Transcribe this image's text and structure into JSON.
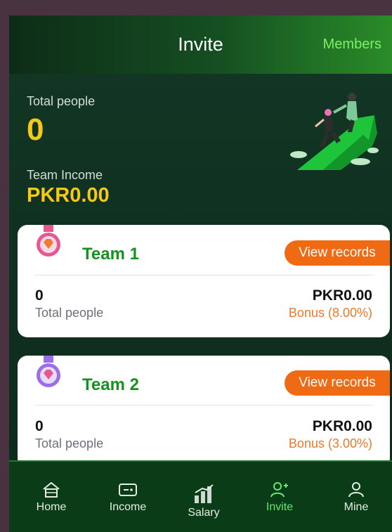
{
  "header": {
    "title": "Invite",
    "members_label": "Members"
  },
  "stats": {
    "total_people_label": "Total people",
    "total_people_value": "0",
    "team_income_label": "Team Income",
    "team_income_value": "PKR0.00"
  },
  "teams": [
    {
      "name": "Team 1",
      "view_label": "View records",
      "count": "0",
      "count_label": "Total people",
      "amount": "PKR0.00",
      "bonus_label": "Bonus (8.00%)",
      "medal_color": "#e8578f"
    },
    {
      "name": "Team 2",
      "view_label": "View records",
      "count": "0",
      "count_label": "Total people",
      "amount": "PKR0.00",
      "bonus_label": "Bonus (3.00%)",
      "medal_color": "#9a6ee6"
    }
  ],
  "tabbar": {
    "items": [
      {
        "label": "Home",
        "icon": "home-icon"
      },
      {
        "label": "Income",
        "icon": "wallet-icon"
      },
      {
        "label": "Salary",
        "icon": "bar-chart-icon"
      },
      {
        "label": "Invite",
        "icon": "add-user-icon"
      },
      {
        "label": "Mine",
        "icon": "person-icon"
      }
    ],
    "active": "Invite"
  },
  "colors": {
    "accent_yellow": "#f6c818",
    "accent_green": "#62ea74",
    "team_name_green": "#14941f",
    "button_orange": "#f06a14",
    "bonus_orange": "#e8792c"
  }
}
